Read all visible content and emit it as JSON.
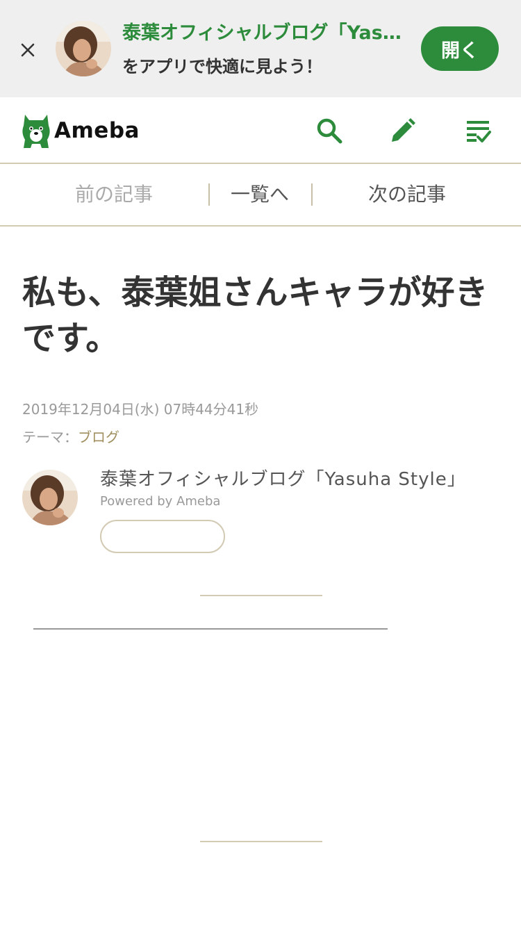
{
  "banner": {
    "title": "泰葉オフィシャルブログ「Yasuha Style」",
    "subtitle": "をアプリで快適に見よう！",
    "open_label": "開く",
    "accent_color": "#2d8c3c",
    "close_icon": "close-icon"
  },
  "header": {
    "logo_text": "Ameba",
    "icons": [
      "search-icon",
      "pencil-icon",
      "checklist-icon"
    ],
    "icon_color": "#2d8c3c"
  },
  "pager": {
    "prev_label": "前の記事",
    "list_label": "一覧へ",
    "next_label": "次の記事"
  },
  "article": {
    "title": "私も、泰葉姐さんキャラが好きです。",
    "date": "2019年12月04日(水) 07時44分41秒",
    "theme_prefix": "テーマ：",
    "theme_link": "ブログ"
  },
  "author": {
    "name": "泰葉オフィシャルブログ「Yasuha Style」",
    "powered_by": "Powered by Ameba",
    "follow_label": ""
  },
  "colors": {
    "border": "#d3cab4",
    "theme_link": "#a08f5f"
  }
}
